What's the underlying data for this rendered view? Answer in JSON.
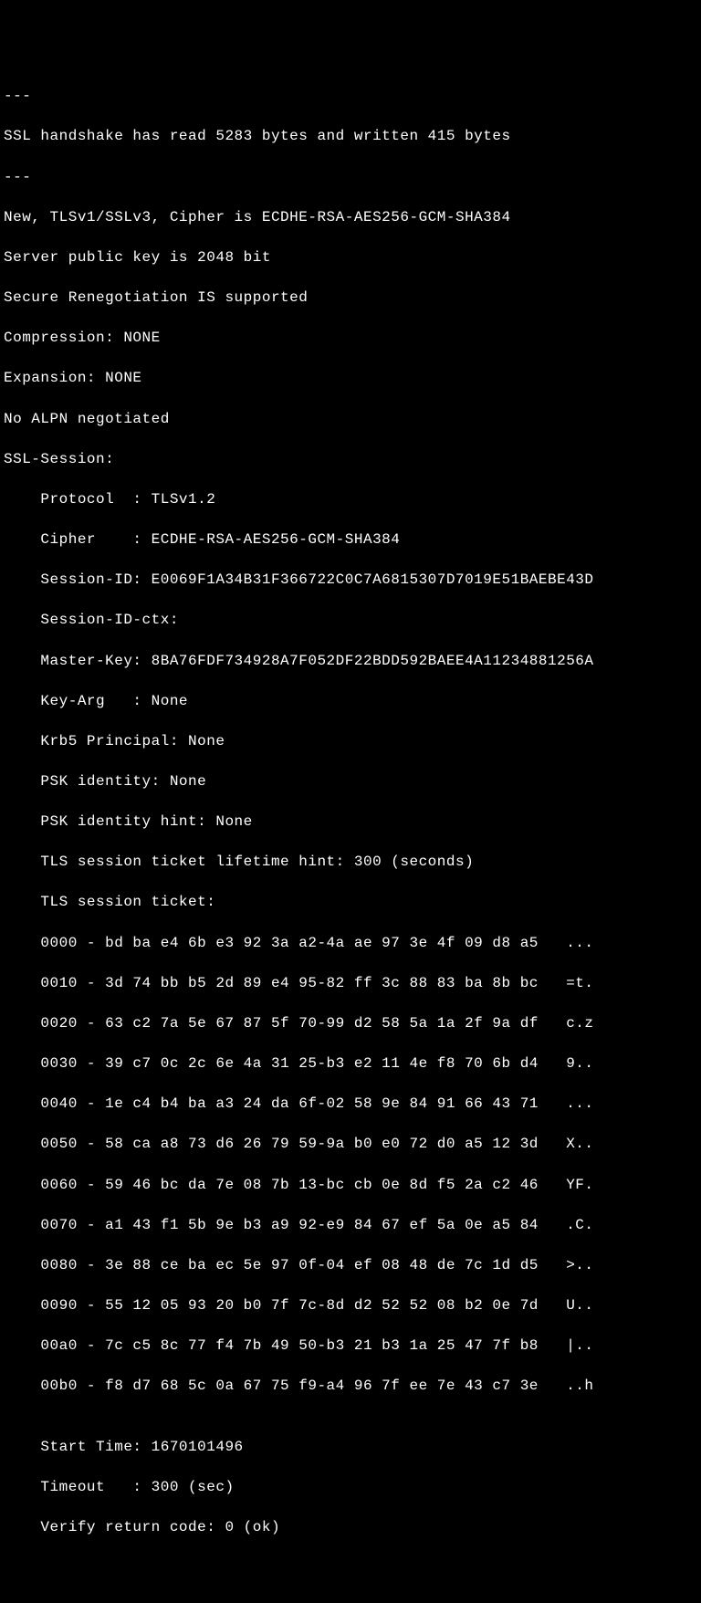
{
  "header": {
    "sep1": "---",
    "handshake": "SSL handshake has read 5283 bytes and written 415 bytes",
    "sep2": "---",
    "new_cipher": "New, TLSv1/SSLv3, Cipher is ECDHE-RSA-AES256-GCM-SHA384",
    "pubkey": "Server public key is 2048 bit",
    "reneg": "Secure Renegotiation IS supported",
    "compression": "Compression: NONE",
    "expansion": "Expansion: NONE",
    "alpn": "No ALPN negotiated"
  },
  "session": {
    "title": "SSL-Session:",
    "protocol": "    Protocol  : TLSv1.2",
    "cipher": "    Cipher    : ECDHE-RSA-AES256-GCM-SHA384",
    "session_id": "    Session-ID: E0069F1A34B31F366722C0C7A6815307D7019E51BAEBE43D",
    "session_id_ctx": "    Session-ID-ctx:",
    "master_key": "    Master-Key: 8BA76FDF734928A7F052DF22BDD592BAEE4A11234881256A",
    "key_arg": "    Key-Arg   : None",
    "krb5": "    Krb5 Principal: None",
    "psk_id": "    PSK identity: None",
    "psk_hint": "    PSK identity hint: None",
    "ticket_life": "    TLS session ticket lifetime hint: 300 (seconds)",
    "ticket_hdr": "    TLS session ticket:"
  },
  "ticket": [
    "    0000 - bd ba e4 6b e3 92 3a a2-4a ae 97 3e 4f 09 d8 a5   ...",
    "    0010 - 3d 74 bb b5 2d 89 e4 95-82 ff 3c 88 83 ba 8b bc   =t.",
    "    0020 - 63 c2 7a 5e 67 87 5f 70-99 d2 58 5a 1a 2f 9a df   c.z",
    "    0030 - 39 c7 0c 2c 6e 4a 31 25-b3 e2 11 4e f8 70 6b d4   9..",
    "    0040 - 1e c4 b4 ba a3 24 da 6f-02 58 9e 84 91 66 43 71   ...",
    "    0050 - 58 ca a8 73 d6 26 79 59-9a b0 e0 72 d0 a5 12 3d   X..",
    "    0060 - 59 46 bc da 7e 08 7b 13-bc cb 0e 8d f5 2a c2 46   YF.",
    "    0070 - a1 43 f1 5b 9e b3 a9 92-e9 84 67 ef 5a 0e a5 84   .C.",
    "    0080 - 3e 88 ce ba ec 5e 97 0f-04 ef 08 48 de 7c 1d d5   >..",
    "    0090 - 55 12 05 93 20 b0 7f 7c-8d d2 52 52 08 b2 0e 7d   U..",
    "    00a0 - 7c c5 8c 77 f4 7b 49 50-b3 21 b3 1a 25 47 7f b8   |..",
    "    00b0 - f8 d7 68 5c 0a 67 75 f9-a4 96 7f ee 7e 43 c7 3e   ..h"
  ],
  "footer": {
    "blank": "",
    "start_time": "    Start Time: 1670101496",
    "timeout": "    Timeout   : 300 (sec)",
    "verify": "    Verify return code: 0 (ok)"
  }
}
